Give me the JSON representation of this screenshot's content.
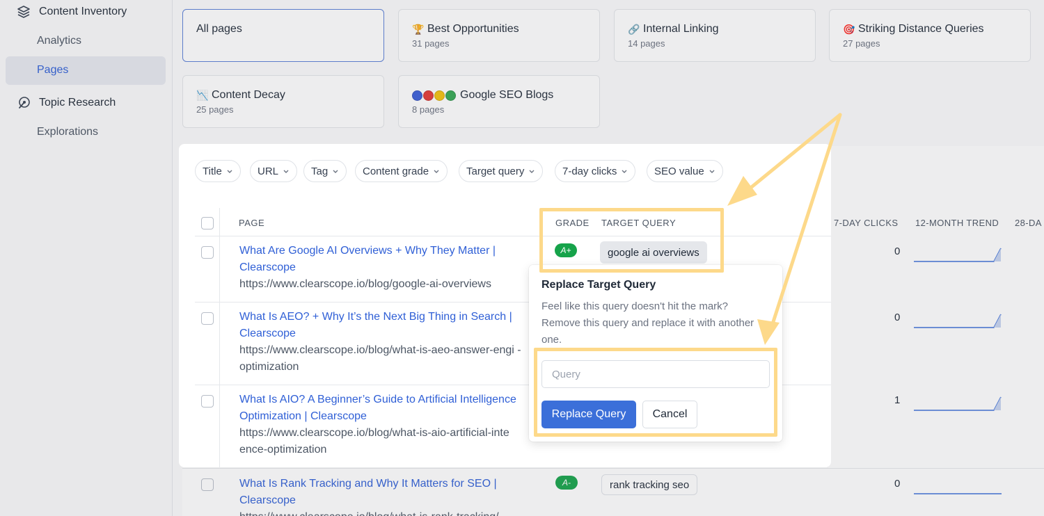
{
  "sidebar": {
    "content_inventory": "Content Inventory",
    "analytics": "Analytics",
    "pages": "Pages",
    "topic_research": "Topic Research",
    "explorations": "Explorations"
  },
  "cards": [
    {
      "title": "All pages",
      "sub": ""
    },
    {
      "emoji": "🏆",
      "title": "Best Opportunities",
      "sub": "31 pages"
    },
    {
      "emoji": "🔗",
      "title": "Internal Linking",
      "sub": "14 pages"
    },
    {
      "emoji": "🎯",
      "title": "Striking Distance Queries",
      "sub": "27 pages"
    },
    {
      "emoji": "📉",
      "title": "Content Decay",
      "sub": "25 pages"
    },
    {
      "title": "Google SEO Blogs",
      "sub": "8 pages"
    }
  ],
  "colors": {
    "dot_blue": "#3b5fd9",
    "dot_red": "#e53935",
    "dot_yellow": "#f4c20d",
    "dot_green": "#34a853",
    "accent": "#3b6fd9",
    "highlight": "#fdd98a"
  },
  "filters": [
    "Title",
    "URL",
    "Tag",
    "Content grade",
    "Target query",
    "7-day clicks",
    "SEO value"
  ],
  "table": {
    "headers": {
      "page": "PAGE",
      "grade": "GRADE",
      "target_query": "TARGET QUERY",
      "clicks": "7-DAY CLICKS",
      "trend": "12-MONTH TREND",
      "day28": "28-DA"
    },
    "rows": [
      {
        "title": "What Are Google AI Overviews + Why They Matter | Clearscope",
        "url": "https://www.clearscope.io/blog/google-ai-overviews",
        "grade": "A+",
        "query": "google ai overviews",
        "clicks": "0"
      },
      {
        "title": "What Is AEO? + Why It’s the Next Big Thing in Search | Clearscope",
        "url": "https://www.clearscope.io/blog/what-is-aeo-answer-engi -optimization",
        "clicks": "0"
      },
      {
        "title": "What Is AIO? A Beginner’s Guide to Artificial Intelligence Optimization | Clearscope",
        "url": "https://www.clearscope.io/blog/what-is-aio-artificial-inte ence-optimization",
        "clicks": "1"
      },
      {
        "title": "What Is Rank Tracking and Why It Matters for SEO | Clearscope",
        "url": "https://www.clearscope.io/blog/what-is-rank-tracking/",
        "grade": "A-",
        "query": "rank tracking seo",
        "clicks": "0"
      }
    ]
  },
  "popover": {
    "title": "Replace Target Query",
    "description": "Feel like this query doesn't hit the mark? Remove this query and replace it with another one.",
    "input_placeholder": "Query",
    "input_value": "",
    "replace_button": "Replace Query",
    "cancel_button": "Cancel"
  }
}
